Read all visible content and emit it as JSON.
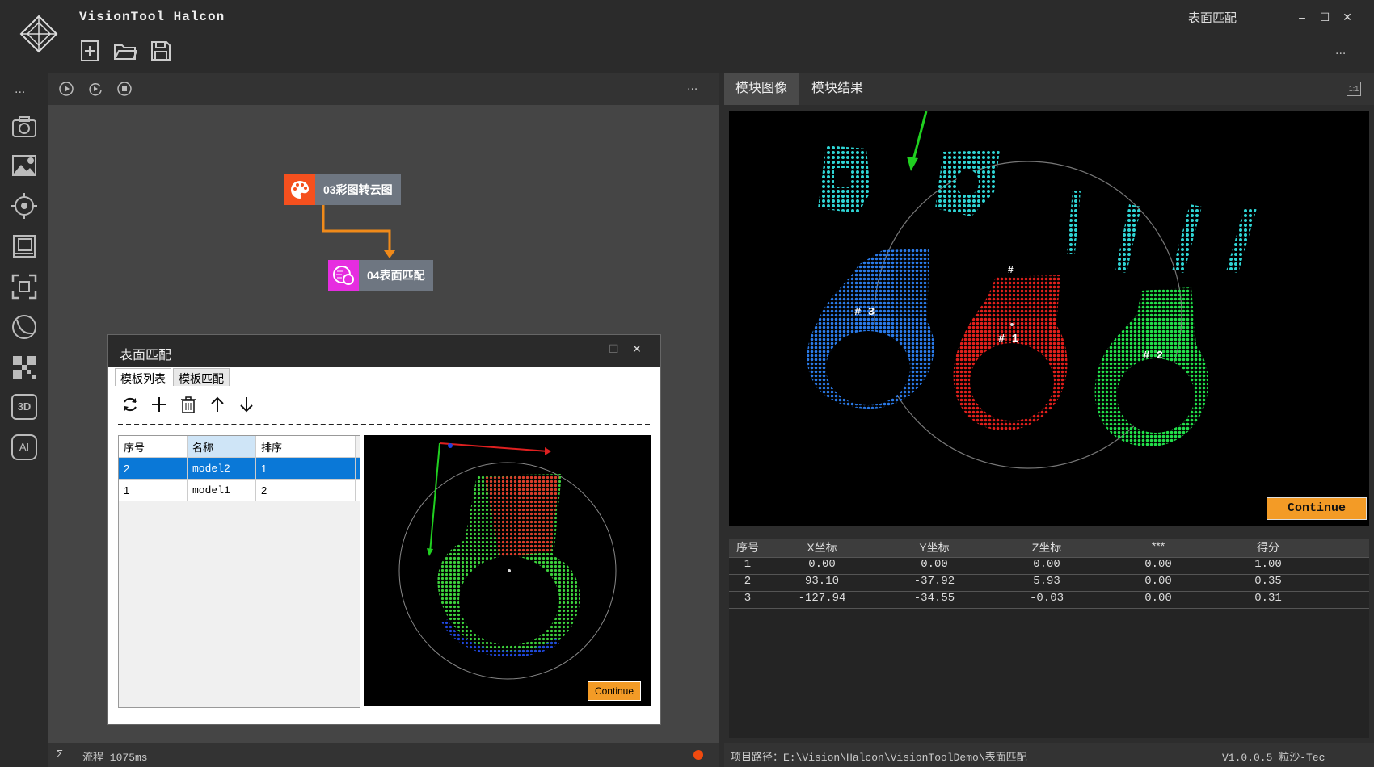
{
  "app": {
    "title": "VisionTool Halcon",
    "module_title": "表面匹配",
    "more": "..."
  },
  "window_controls": {
    "minimize": "–",
    "maximize": "☐",
    "close": "✕"
  },
  "sidebar": {
    "more": "...",
    "items": [
      "camera-icon",
      "image-settings-icon",
      "target-icon",
      "layers-icon",
      "roi-icon",
      "chart-curve-icon",
      "qr-code-icon",
      "3d-icon",
      "ai-icon"
    ],
    "labels": {
      "3d": "3D",
      "ai": "AI"
    }
  },
  "flow": {
    "more": "...",
    "nodes": [
      {
        "label": "03彩图转云图",
        "color": "#f5501e"
      },
      {
        "label": "04表面匹配",
        "color": "#e62de0"
      }
    ],
    "status": {
      "sigma": "Σ",
      "text": "流程 1075ms",
      "indicator_color": "#f04a0f"
    }
  },
  "dialog": {
    "title": "表面匹配",
    "tabs": [
      "模板列表",
      "模板匹配"
    ],
    "table": {
      "headers": [
        "序号",
        "名称",
        "排序"
      ],
      "rows": [
        [
          "2",
          "model2",
          "1"
        ],
        [
          "1",
          "model1",
          "2"
        ]
      ]
    },
    "continue_label": "Continue"
  },
  "right": {
    "tabs": [
      "模块图像",
      "模块结果"
    ],
    "zoom_label": "1:1",
    "continue_label": "Continue",
    "labels": [
      "# 3",
      "# 1",
      "# 2"
    ],
    "result_table": {
      "headers": [
        "序号",
        "X坐标",
        "Y坐标",
        "Z坐标",
        "***",
        "得分"
      ],
      "rows": [
        [
          "1",
          "0.00",
          "0.00",
          "0.00",
          "0.00",
          "1.00"
        ],
        [
          "2",
          "93.10",
          "-37.92",
          "5.93",
          "0.00",
          "0.35"
        ],
        [
          "3",
          "-127.94",
          "-34.55",
          "-0.03",
          "0.00",
          "0.31"
        ]
      ]
    },
    "status": {
      "path": "项目路径：E:\\Vision\\Halcon\\VisionToolDemo\\表面匹配",
      "version": "V1.0.0.5 粒沙-Tec"
    }
  }
}
